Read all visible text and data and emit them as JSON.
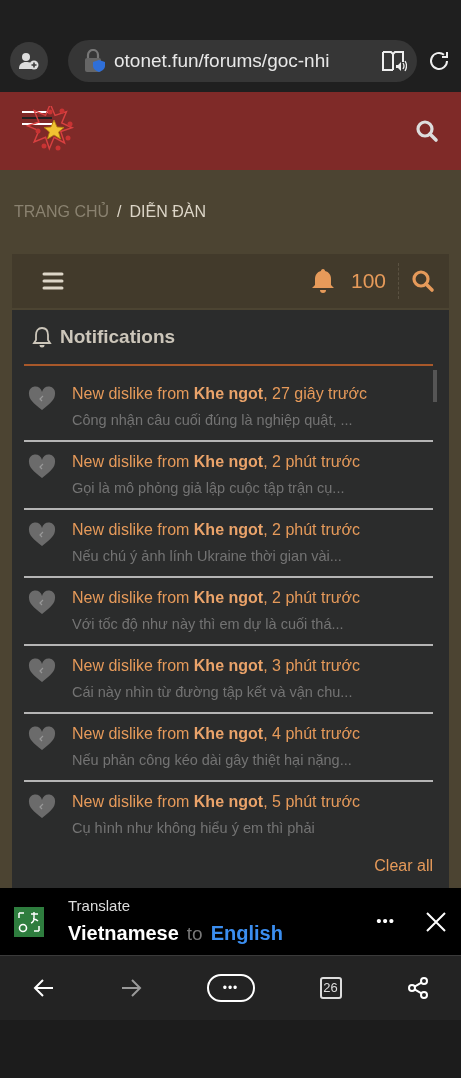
{
  "browser": {
    "url": "otonet.fun/forums/goc-nhi"
  },
  "breadcrumb": [
    {
      "label": "TRANG CHỦ",
      "dimmed": true
    },
    {
      "label": "/",
      "dimmed": false
    },
    {
      "label": "DIỄN ĐÀN",
      "dimmed": false
    }
  ],
  "toolbar": {
    "alert_count": "100"
  },
  "notifications": {
    "title": "Notifications",
    "items": [
      {
        "text": "New dislike from **Khe ngot**, 27 giây trước",
        "snippet": "Công nhận câu cuối đúng là nghiệp quật, ..."
      },
      {
        "text": "New dislike from **Khe ngot**, 2 phút trước",
        "snippet": "Gọi là mô phỏng giả lập cuộc tập trận cụ..."
      },
      {
        "text": "New dislike from **Khe ngot**, 2 phút trước",
        "snippet": "Nếu chú ý ảnh lính Ukraine thời gian vài..."
      },
      {
        "text": "New dislike from **Khe ngot**, 2 phút trước",
        "snippet": "Với tốc độ như này thì em dự là cuối thá..."
      },
      {
        "text": "New dislike from **Khe ngot**, 3 phút trước",
        "snippet": "Cái này nhìn từ đường tập kết và vận chu..."
      },
      {
        "text": "New dislike from **Khe ngot**, 4 phút trước",
        "snippet": "Nếu phản công kéo dài gây thiệt hại nặng..."
      },
      {
        "text": "New dislike from **Khe ngot**, 5 phút trước",
        "snippet": "Cụ hình như không hiểu ý em thì phải"
      }
    ],
    "clear_label": "Clear all"
  },
  "translate_bar": {
    "title": "Translate",
    "from": "Vietnamese",
    "joiner": "to",
    "to": "English",
    "more": "•••"
  },
  "bottom_nav": {
    "menu": "•••",
    "tab_count": "26"
  }
}
